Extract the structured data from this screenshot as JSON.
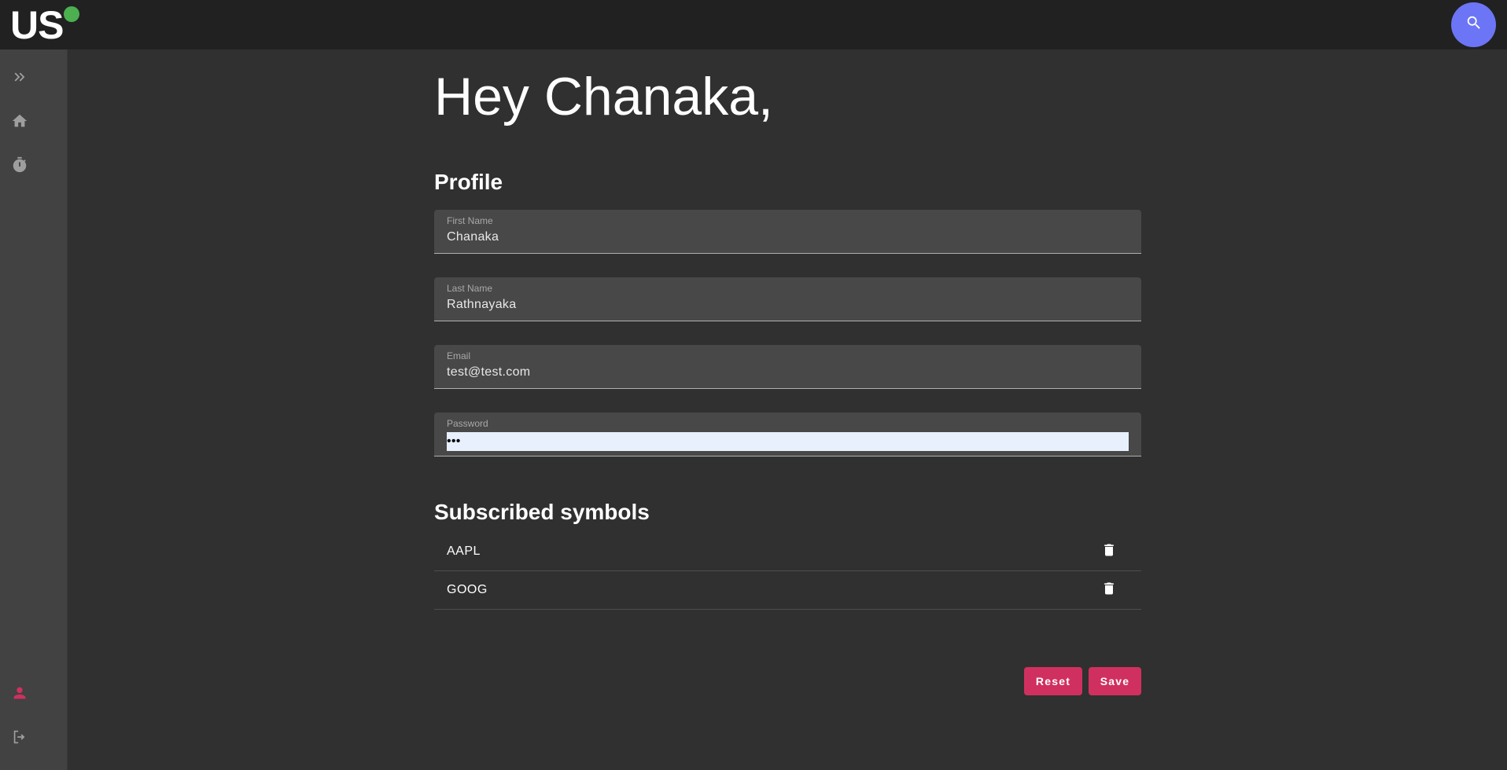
{
  "header": {
    "logo_text": "US",
    "status_color": "#4caf50",
    "search_icon": "search-icon"
  },
  "sidebar": {
    "items": [
      {
        "name": "expand",
        "icon": "double-chevron-right-icon"
      },
      {
        "name": "home",
        "icon": "home-icon"
      },
      {
        "name": "timer",
        "icon": "timer-icon"
      },
      {
        "name": "profile",
        "icon": "person-icon",
        "active_color": "#d0305f"
      },
      {
        "name": "logout",
        "icon": "logout-icon"
      }
    ]
  },
  "main": {
    "greeting": "Hey Chanaka,",
    "profile_title": "Profile",
    "fields": {
      "first_name": {
        "label": "First Name",
        "value": "Chanaka"
      },
      "last_name": {
        "label": "Last Name",
        "value": "Rathnayaka"
      },
      "email": {
        "label": "Email",
        "value": "test@test.com"
      },
      "password": {
        "label": "Password",
        "value": "•••"
      }
    },
    "symbols_title": "Subscribed symbols",
    "symbols": [
      {
        "name": "AAPL"
      },
      {
        "name": "GOOG"
      }
    ],
    "reset_label": "Reset",
    "save_label": "Save"
  },
  "colors": {
    "accent": "#d0305f",
    "fab": "#6c75f5",
    "background": "#303030",
    "topbar": "#212121",
    "sidebar": "#424242"
  }
}
